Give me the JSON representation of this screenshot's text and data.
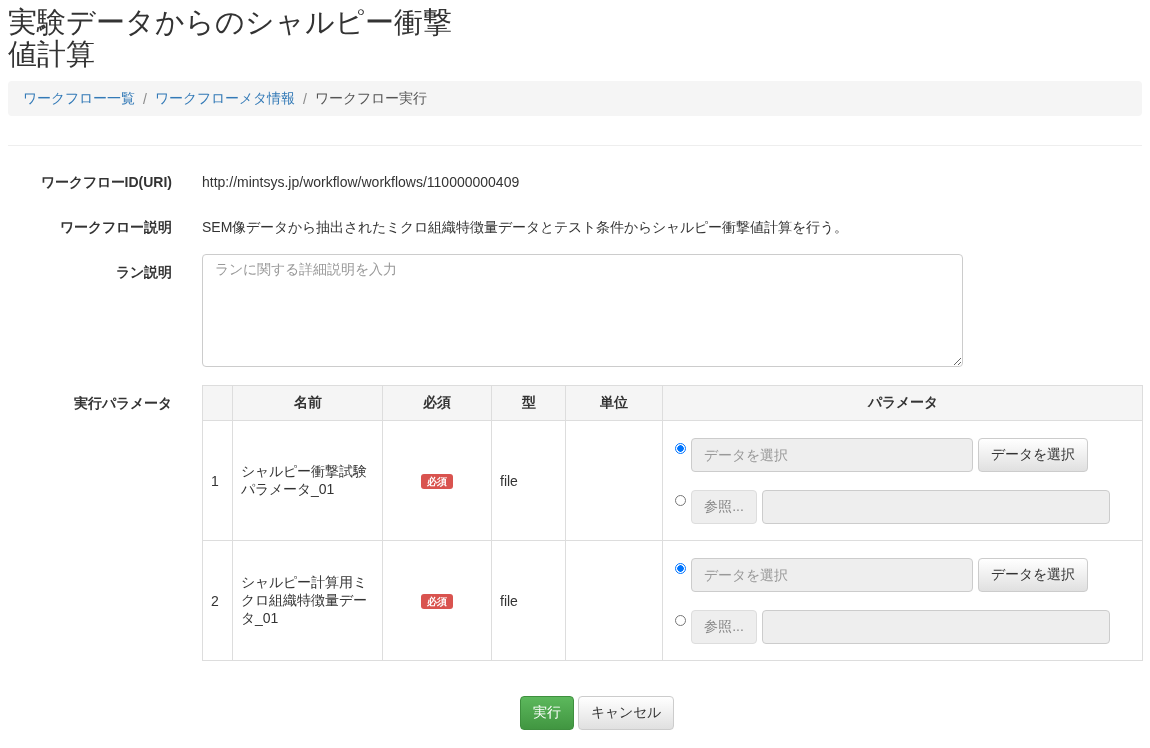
{
  "title": "実験データからのシャルピー衝撃値計算",
  "breadcrumb_separator": "/",
  "breadcrumb": [
    {
      "label": "ワークフロー一覧",
      "link": true
    },
    {
      "label": "ワークフローメタ情報",
      "link": true
    },
    {
      "label": "ワークフロー実行",
      "link": false
    }
  ],
  "fields": [
    {
      "label": "ワークフローID(URI)",
      "kind": "text",
      "value": "http://mintsys.jp/workflow/workflows/110000000409"
    },
    {
      "label": "ワークフロー説明",
      "kind": "text",
      "value": "SEM像データから抽出されたミクロ組織特徴量データとテスト条件からシャルピー衝撃値計算を行う。"
    },
    {
      "label": "ラン説明",
      "kind": "textarea",
      "placeholder": "ランに関する詳細説明を入力"
    },
    {
      "label": "実行パラメータ",
      "kind": "table"
    }
  ],
  "table": {
    "columns": [
      "名前",
      "必須",
      "型",
      "単位",
      "パラメータ"
    ],
    "rows": [
      {
        "index": "1",
        "name": "シャルピー衝撃試験パラメータ_01",
        "required": true,
        "badge": "必須",
        "type": "file",
        "options": [
          {
            "kind": "data",
            "selected": true,
            "placeholder": "データを選択",
            "button": "データを選択"
          },
          {
            "kind": "file",
            "selected": false,
            "button": "参照..."
          }
        ]
      },
      {
        "index": "2",
        "name": "シャルピー計算用ミクロ組織特徴量データ_01",
        "required": true,
        "badge": "必須",
        "type": "file",
        "options": [
          {
            "kind": "data",
            "selected": true,
            "placeholder": "データを選択",
            "button": "データを選択"
          },
          {
            "kind": "file",
            "selected": false,
            "button": "参照..."
          }
        ]
      }
    ]
  },
  "buttons": [
    {
      "label": "実行",
      "kind": "primary"
    },
    {
      "label": "キャンセル",
      "kind": "default"
    }
  ]
}
